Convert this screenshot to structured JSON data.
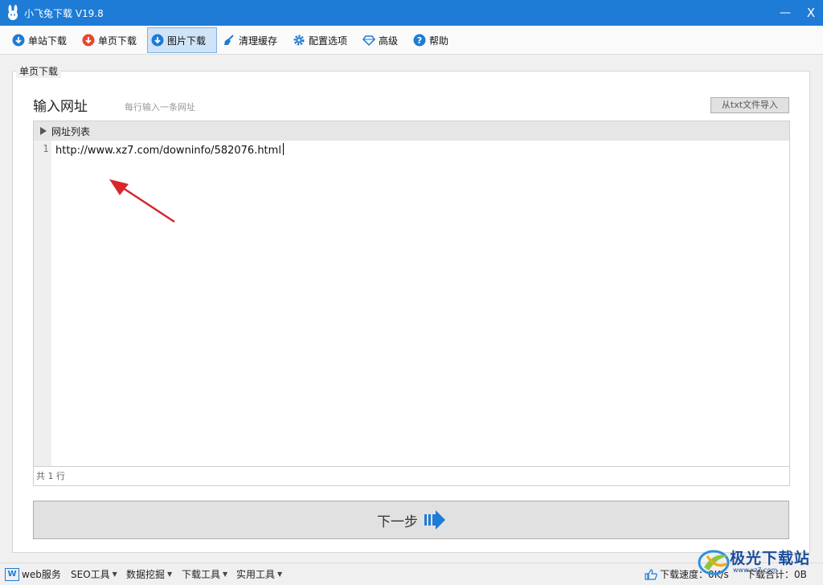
{
  "window": {
    "title": "小飞兔下载 V19.8",
    "minimize_label": "—",
    "close_label": "X"
  },
  "toolbar": {
    "items": [
      {
        "label": "单站下载",
        "icon": "cloud-download-icon",
        "color": "#1e7bd6"
      },
      {
        "label": "单页下载",
        "icon": "cloud-download-icon",
        "color": "#e8472a"
      },
      {
        "label": "图片下载",
        "icon": "cloud-download-icon",
        "color": "#1e7bd6",
        "active": true
      },
      {
        "label": "清理缓存",
        "icon": "broom-icon",
        "color": "#1e7bd6"
      },
      {
        "label": "配置选项",
        "icon": "gear-icon",
        "color": "#1e7bd6"
      },
      {
        "label": "高级",
        "icon": "diamond-icon",
        "color": "#1e7bd6"
      },
      {
        "label": "帮助",
        "icon": "help-icon",
        "color": "#1e7bd6"
      }
    ]
  },
  "panel": {
    "group_title": "单页下载",
    "heading": "输入网址",
    "hint": "每行输入一条网址",
    "import_button": "从txt文件导入",
    "editor_header": "网址列表",
    "line_number": "1",
    "url": "http://www.xz7.com/downinfo/582076.html",
    "line_count": "共 1 行",
    "next_button": "下一步"
  },
  "statusbar": {
    "web_logo": "W",
    "items": [
      "web服务",
      "SEO工具",
      "数据挖掘",
      "下载工具",
      "实用工具"
    ],
    "speed": "下载速度：0K/s",
    "total": "下载合计：0B"
  },
  "watermark": {
    "text": "极光下载站",
    "sub": "www.xz7.com"
  },
  "colors": {
    "titlebar": "#1e7bd6",
    "accent": "#1e7bd6",
    "arrow": "#d9262b"
  }
}
